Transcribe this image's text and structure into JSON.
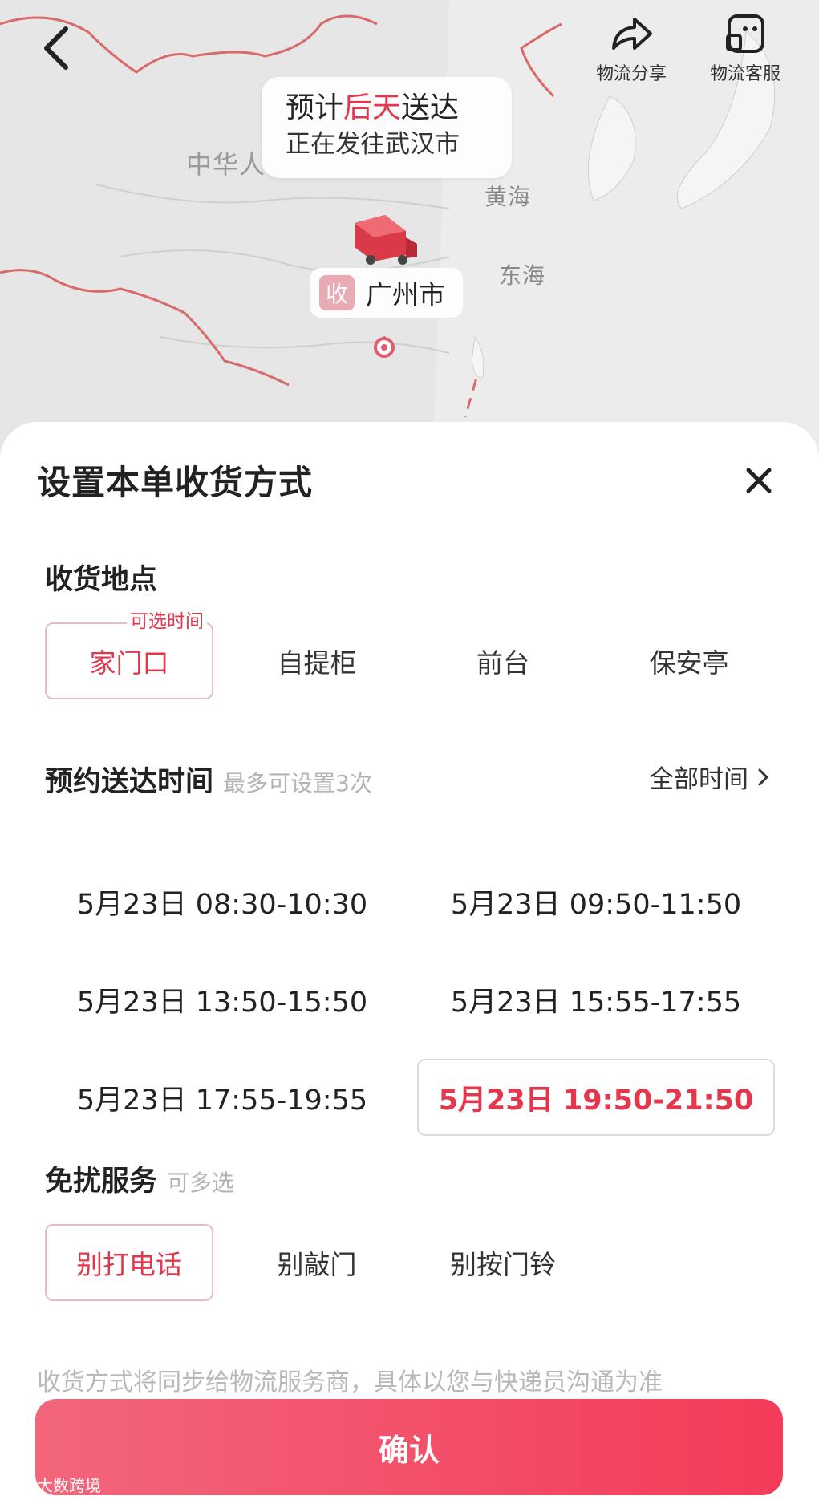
{
  "map": {
    "back_icon": "chevron-left-icon",
    "share_label": "物流分享",
    "service_label": "物流客服",
    "eta_prefix": "预计",
    "eta_highlight": "后天",
    "eta_suffix": "送达",
    "eta_status": "正在发往武汉市",
    "labels": {
      "country": "中华人",
      "yellow_sea": "黄海",
      "east_sea": "东海"
    },
    "origin_tag": "收",
    "origin_city": "广州市"
  },
  "sheet": {
    "title": "设置本单收货方式",
    "location": {
      "title": "收货地点",
      "options": [
        {
          "label": "家门口",
          "badge": "可选时间",
          "selected": true
        },
        {
          "label": "自提柜",
          "selected": false
        },
        {
          "label": "前台",
          "selected": false
        },
        {
          "label": "保安亭",
          "selected": false
        }
      ]
    },
    "time": {
      "title": "预约送达时间",
      "hint": "最多可设置3次",
      "all_link": "全部时间",
      "slots": [
        {
          "label": "5月23日 08:30-10:30",
          "selected": false
        },
        {
          "label": "5月23日 09:50-11:50",
          "selected": false
        },
        {
          "label": "5月23日 13:50-15:50",
          "selected": false
        },
        {
          "label": "5月23日 15:55-17:55",
          "selected": false
        },
        {
          "label": "5月23日 17:55-19:55",
          "selected": false
        },
        {
          "label": "5月23日 19:50-21:50",
          "selected": true
        }
      ]
    },
    "nodisturb": {
      "title": "免扰服务",
      "hint": "可多选",
      "options": [
        {
          "label": "别打电话",
          "selected": true
        },
        {
          "label": "别敲门",
          "selected": false
        },
        {
          "label": "别按门铃",
          "selected": false
        }
      ]
    },
    "note": "收货方式将同步给物流服务商，具体以您与快递员沟通为准",
    "confirm_label": "确认"
  },
  "watermark": "大数跨境",
  "colors": {
    "accent": "#e5374c",
    "button_start": "#f2667b",
    "button_end": "#f43b5a",
    "border_red": "#e25c6e"
  }
}
